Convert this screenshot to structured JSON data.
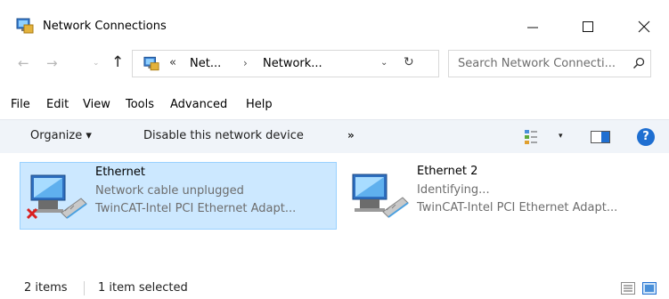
{
  "window": {
    "title": "Network Connections",
    "controls": {
      "minimize": "—",
      "maximize": "☐",
      "close": "✕"
    }
  },
  "address": {
    "back": "←",
    "forward": "→",
    "history": "⌄",
    "up": "↑",
    "overflow": "«",
    "crumbs": [
      "Net...",
      "Network..."
    ],
    "separator": "›",
    "dropdown": "⌄",
    "refresh": "↻"
  },
  "search": {
    "placeholder": "Search Network Connecti..."
  },
  "menu": {
    "items": [
      "File",
      "Edit",
      "View",
      "Tools",
      "Advanced",
      "Help"
    ]
  },
  "commands": {
    "organize": "Organize ▾",
    "disable": "Disable this network device",
    "more": "»",
    "view_dropdown": "▾",
    "help": "?"
  },
  "items": [
    {
      "name": "Ethernet",
      "status": "Network cable unplugged",
      "device": "TwinCAT-Intel PCI Ethernet Adapt...",
      "selected": true,
      "error": true
    },
    {
      "name": "Ethernet 2",
      "status": "Identifying...",
      "device": "TwinCAT-Intel PCI Ethernet Adapt...",
      "selected": false,
      "error": false
    }
  ],
  "status_bar": {
    "count": "2 items",
    "selection": "1 item selected"
  },
  "colors": {
    "selection_bg": "#cce8ff",
    "selection_border": "#99d1ff",
    "command_bar_bg": "#f0f4f9",
    "help_blue": "#1f6fd1",
    "error_red": "#d92020"
  }
}
